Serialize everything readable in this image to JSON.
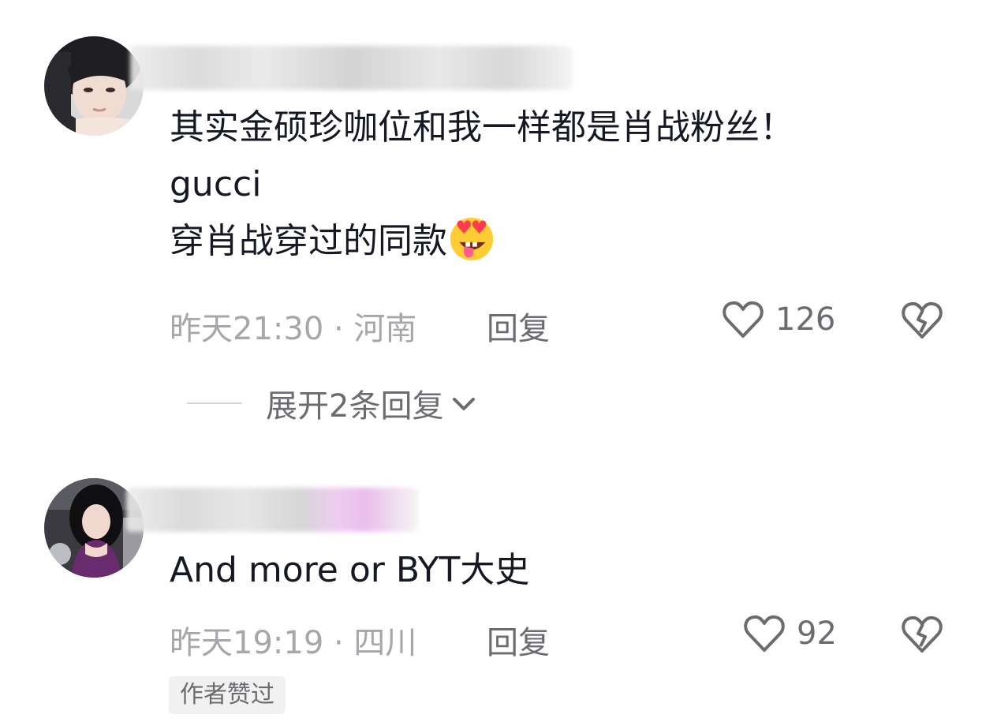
{
  "comments": [
    {
      "text_lines": [
        "其实金硕珍咖位和我一样都是肖战粉丝！",
        "gucci",
        "穿肖战穿过的同款"
      ],
      "emoji": "heart-eyes-tongue-emoji",
      "meta": "昨天21:30 · 河南",
      "reply_label": "回复",
      "likes": "126",
      "expand_label": "展开2条回复"
    },
    {
      "text": "And more or BYT大史",
      "meta": "昨天19:19 · 四川",
      "reply_label": "回复",
      "likes": "92",
      "badge": "作者赞过"
    }
  ],
  "colors": {
    "text": "#161823",
    "meta": "#a7a7ab",
    "secondary": "#6b6b70",
    "badge_bg": "#f1f1f2"
  },
  "icons": [
    "heart-outline-icon",
    "broken-heart-icon",
    "chevron-down-icon"
  ]
}
